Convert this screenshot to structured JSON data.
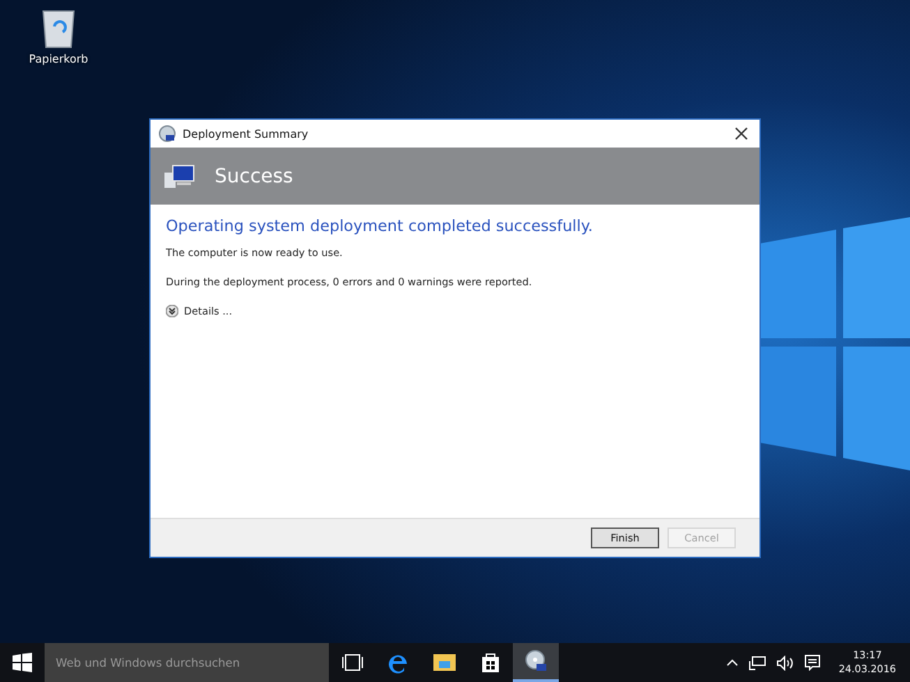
{
  "desktop": {
    "icons": [
      {
        "label": "Papierkorb"
      }
    ]
  },
  "window": {
    "title": "Deployment Summary",
    "header": "Success",
    "heading": "Operating system deployment completed successfully.",
    "messages": [
      "The computer is now ready to use.",
      "During the deployment process, 0 errors and 0 warnings were reported."
    ],
    "details": {
      "label": "Details ...",
      "expanded": false
    },
    "buttons": [
      {
        "label": "Finish",
        "disabled": false
      },
      {
        "label": "Cancel",
        "disabled": true
      }
    ]
  },
  "taskbar": {
    "search": {
      "placeholder": "Web und Windows durchsuchen"
    },
    "apps": [
      {
        "kind": "taskview",
        "selected": false
      },
      {
        "kind": "edge",
        "selected": false
      },
      {
        "kind": "explorer",
        "selected": false
      },
      {
        "kind": "store",
        "selected": false
      },
      {
        "kind": "deploy",
        "selected": true
      }
    ],
    "clock": {
      "time": "13:17",
      "date": "24.03.2016"
    }
  }
}
